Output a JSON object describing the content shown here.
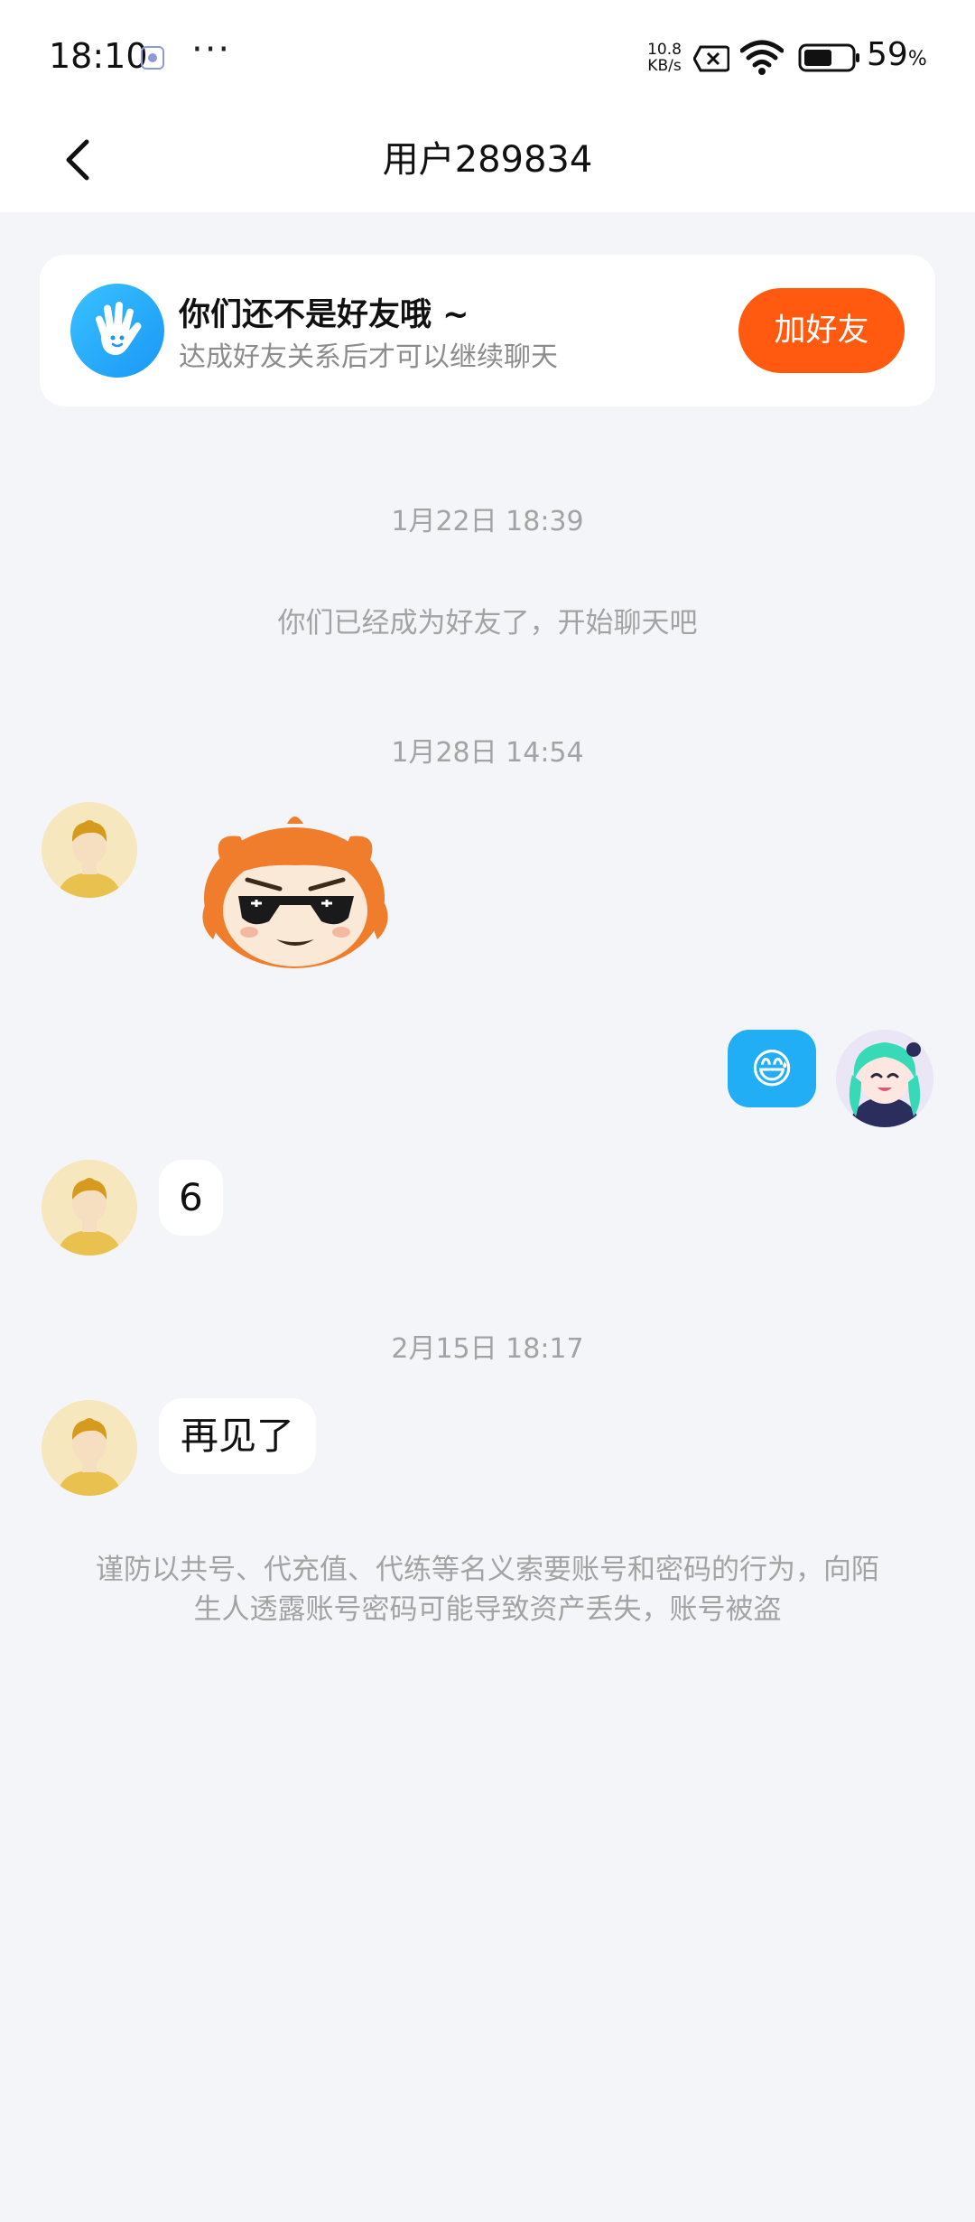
{
  "status_bar": {
    "time": "18:10",
    "more": "···",
    "net_speed_value": "10.8",
    "net_speed_unit": "KB/s",
    "battery_percent": "59",
    "battery_unit": "%",
    "battery_level": 0.59,
    "icons": [
      "app-notification-icon",
      "no-data-icon",
      "wifi-icon",
      "battery-icon"
    ]
  },
  "header": {
    "title": "用户289834"
  },
  "friend_banner": {
    "title": "你们还不是好友哦 ~",
    "subtitle": "达成好友关系后才可以继续聊天",
    "button": "加好友",
    "icon": "wave-hand-icon"
  },
  "messages": {
    "ts1": "1月22日 18:39",
    "system": "你们已经成为好友了，开始聊天吧",
    "ts2": "1月28日 14:54",
    "outgoing_emoji": "😅",
    "incoming_1": "6",
    "ts3": "2月15日 18:17",
    "incoming_2": "再见了"
  },
  "warning": {
    "line1": "谨防以共号、代充值、代练等名义索要账号和密码的行为，向陌",
    "line2": "生人透露账号密码可能导致资产丢失，账号被盗"
  },
  "colors": {
    "accent": "#ff5a0f",
    "bubble_self": "#22aef5",
    "background": "#f3f5f8"
  }
}
